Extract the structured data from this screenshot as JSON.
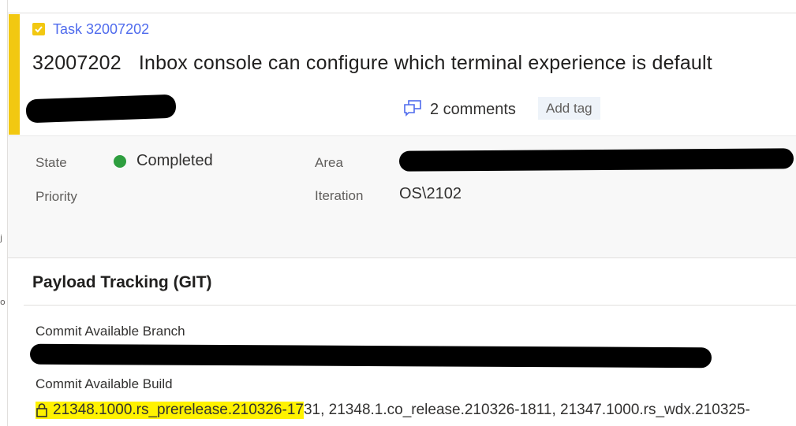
{
  "colors": {
    "accent": "#F2C811",
    "link": "#4F6BED",
    "completed_dot": "#2E9E3F",
    "highlight": "#FFF200",
    "redaction": "#000000"
  },
  "left_strip": {
    "glyph_1": "j",
    "glyph_2": "o"
  },
  "work_item": {
    "type_icon": "task-check-icon",
    "type_link": "Task 32007202",
    "id": "32007202",
    "title": "Inbox console can configure which terminal experience is default",
    "comments_icon": "comments-icon",
    "comments_label": "2 comments",
    "add_tag_label": "Add tag"
  },
  "fields": {
    "state_label": "State",
    "state_value": "Completed",
    "priority_label": "Priority",
    "area_label": "Area",
    "iteration_label": "Iteration",
    "iteration_value": "OS\\2102"
  },
  "payload": {
    "title": "Payload Tracking (GIT)",
    "branch_label": "Commit Available Branch",
    "build_label": "Commit Available Build",
    "lock_icon": "lock-icon",
    "builds_highlighted": "21348.1000.rs_prerelease.210326-17",
    "builds_rest": "31, 21348.1.co_release.210326-1811, 21347.1000.rs_wdx.210325-"
  }
}
